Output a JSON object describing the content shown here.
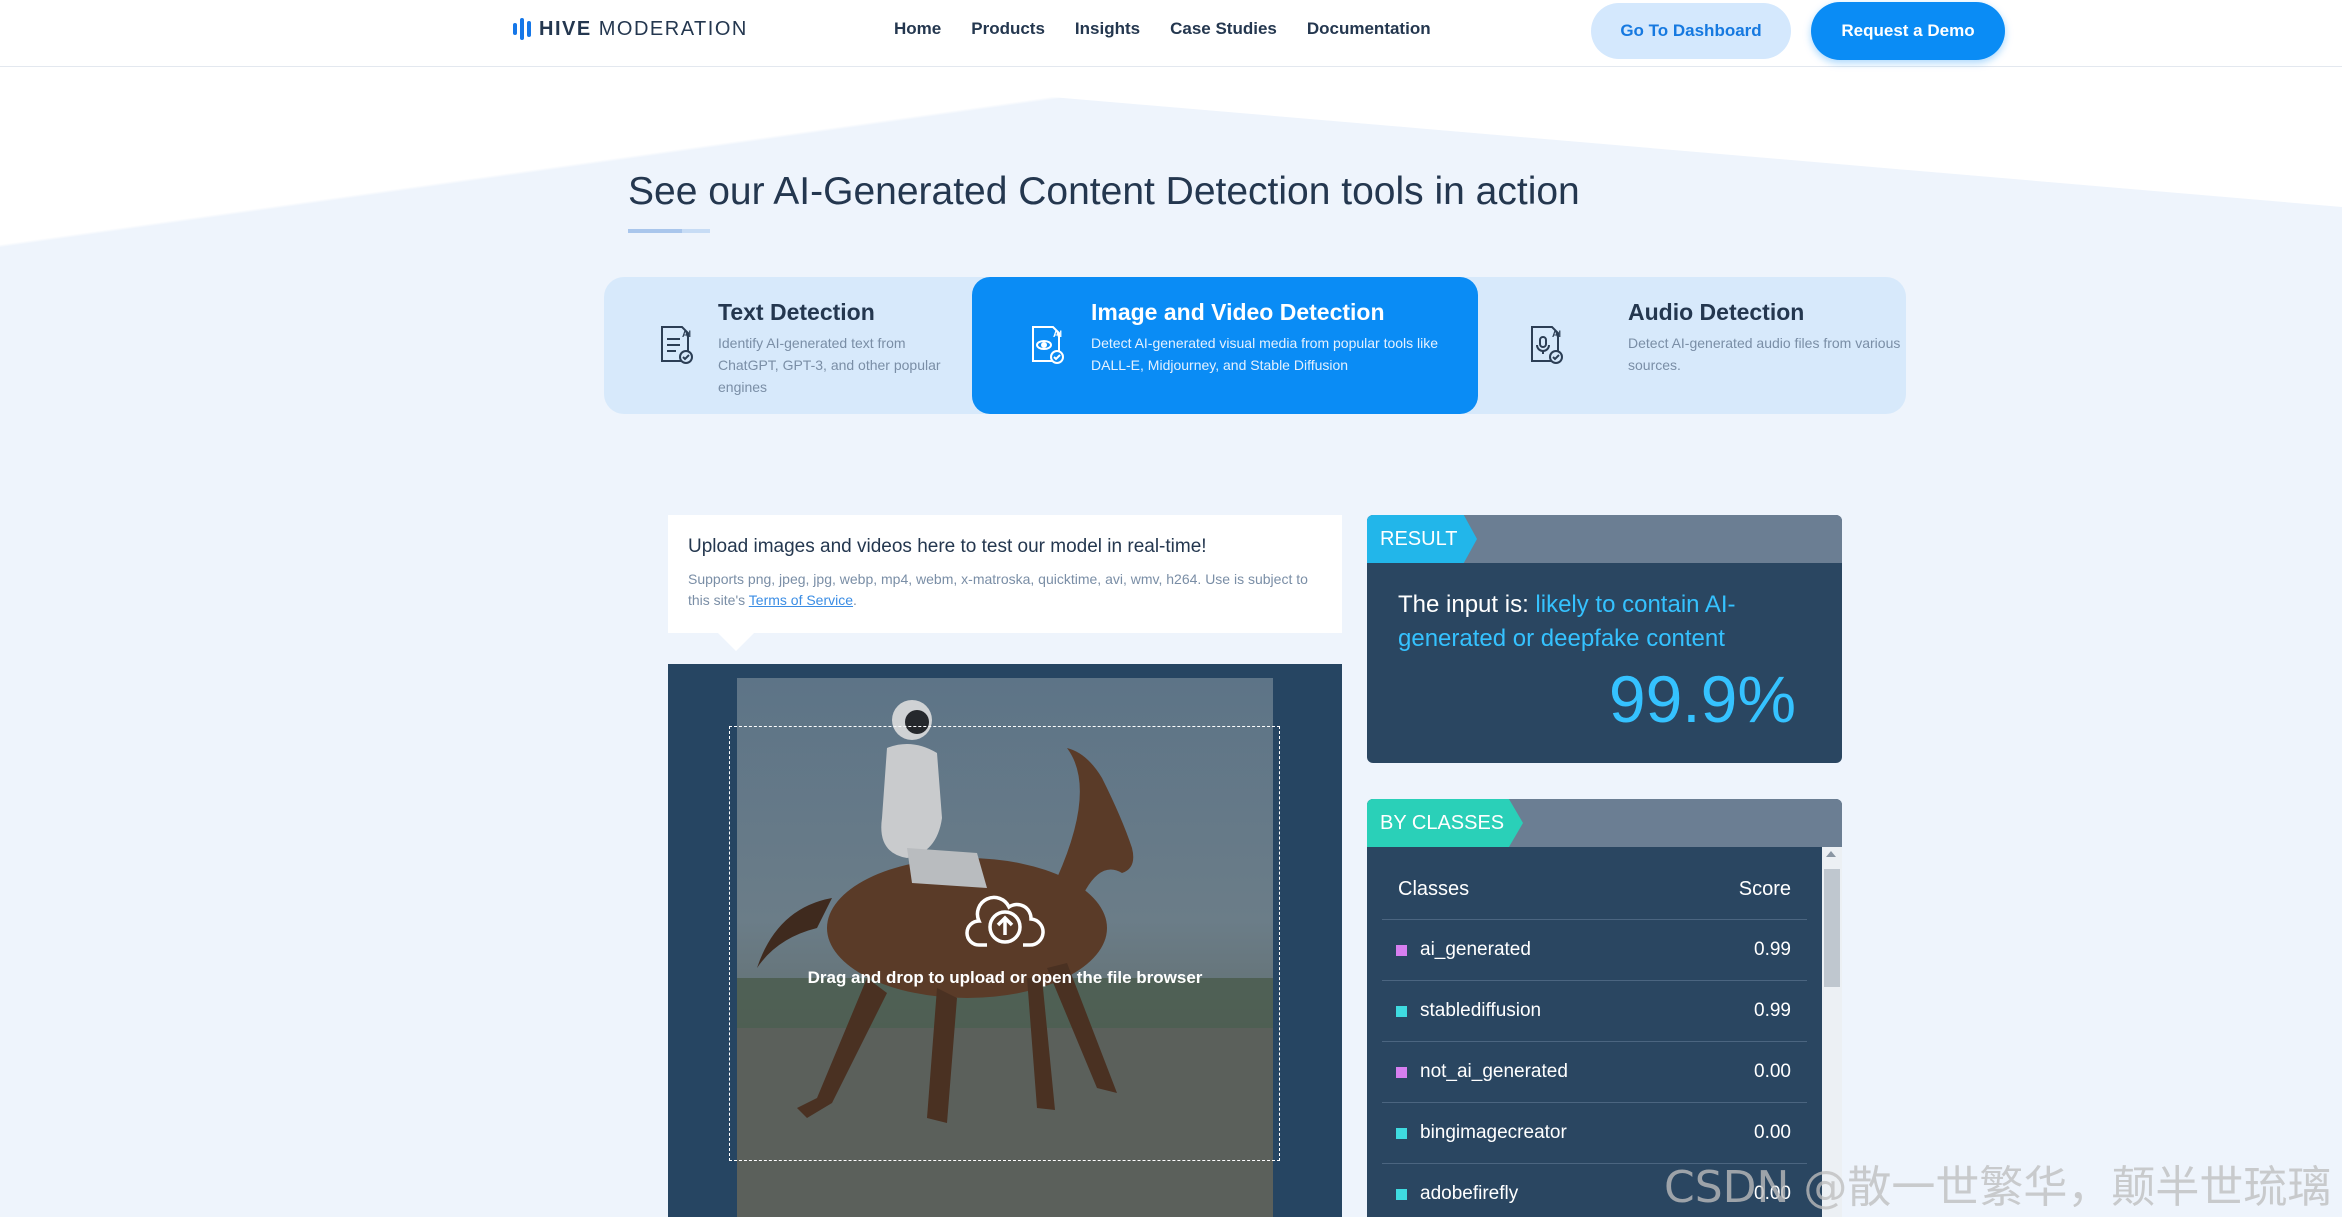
{
  "header": {
    "logo_bold": "HIVE",
    "logo_light": "MODERATION",
    "nav": [
      "Home",
      "Products",
      "Insights",
      "Case Studies",
      "Documentation"
    ],
    "dashboard_label": "Go To Dashboard",
    "demo_label": "Request a Demo"
  },
  "section": {
    "title": "See our AI-Generated Content Detection tools in action"
  },
  "tabs": [
    {
      "icon": "ai-text-icon",
      "title": "Text Detection",
      "desc": "Identify AI-generated text from ChatGPT, GPT-3, and other popular engines",
      "active": false
    },
    {
      "icon": "ai-image-icon",
      "title": "Image and Video Detection",
      "desc": "Detect AI-generated visual media from popular tools like DALL-E, Midjourney, and Stable Diffusion",
      "active": true
    },
    {
      "icon": "ai-audio-icon",
      "title": "Audio Detection",
      "desc": "Detect AI-generated audio files from various sources.",
      "active": false
    }
  ],
  "upload": {
    "title": "Upload images and videos here to test our model in real-time!",
    "desc_prefix": "Supports png, jpeg, jpg, webp, mp4, webm, x-matroska, quicktime, avi, wmv, h264. Use is subject to this site's ",
    "terms_label": "Terms of Service",
    "desc_suffix": ".",
    "drop_text": "Drag and drop to upload or open the file browser"
  },
  "result": {
    "tag": "RESULT",
    "prefix": "The input is: ",
    "verdict": "likely to contain AI-generated or deepfake content",
    "score": "99.9%"
  },
  "classes": {
    "tag": "BY CLASSES",
    "col_class": "Classes",
    "col_score": "Score",
    "rows": [
      {
        "name": "ai_generated",
        "score": "0.99",
        "color": "#d77ff0"
      },
      {
        "name": "stablediffusion",
        "score": "0.99",
        "color": "#3fdbe0"
      },
      {
        "name": "not_ai_generated",
        "score": "0.00",
        "color": "#d77ff0"
      },
      {
        "name": "bingimagecreator",
        "score": "0.00",
        "color": "#3fdbe0"
      },
      {
        "name": "adobefirefly",
        "score": "0.00",
        "color": "#3fdbe0"
      }
    ]
  },
  "watermark": "CSDN @散一世繁华，颠半世琉璃",
  "colors": {
    "primary": "#0a8cf5",
    "panel": "#2a4661",
    "accent_result": "#22b6ea",
    "accent_classes": "#2ad0b8",
    "score_text": "#35c2ff"
  }
}
